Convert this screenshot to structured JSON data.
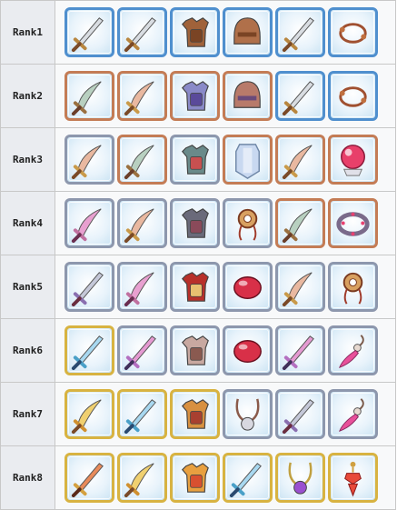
{
  "frame_colors": {
    "blue": "#4f8fce",
    "copper": "#c47c55",
    "silver": "#8d97ad",
    "gold": "#d8b341"
  },
  "ranks": [
    {
      "label": "Rank1",
      "items": [
        {
          "icon": "sword-icon",
          "frame": "blue"
        },
        {
          "icon": "sword-icon",
          "frame": "blue"
        },
        {
          "icon": "leather-armor-icon",
          "frame": "blue"
        },
        {
          "icon": "leather-helmet-icon",
          "frame": "blue"
        },
        {
          "icon": "sword-icon",
          "frame": "blue"
        },
        {
          "icon": "cord-bracelet-icon",
          "frame": "blue"
        }
      ]
    },
    {
      "label": "Rank2",
      "items": [
        {
          "icon": "serrated-sickle-icon",
          "frame": "copper"
        },
        {
          "icon": "curved-dagger-icon",
          "frame": "copper"
        },
        {
          "icon": "plate-armor-icon",
          "frame": "copper"
        },
        {
          "icon": "plumed-helmet-icon",
          "frame": "copper"
        },
        {
          "icon": "sword-icon",
          "frame": "blue"
        },
        {
          "icon": "cord-bracelet-icon",
          "frame": "blue"
        }
      ]
    },
    {
      "label": "Rank3",
      "items": [
        {
          "icon": "curved-dagger-icon",
          "frame": "silver"
        },
        {
          "icon": "serrated-sickle-icon",
          "frame": "copper"
        },
        {
          "icon": "robot-armor-icon",
          "frame": "silver"
        },
        {
          "icon": "crystal-shield-icon",
          "frame": "copper"
        },
        {
          "icon": "curved-dagger-icon",
          "frame": "copper"
        },
        {
          "icon": "crystal-ball-icon",
          "frame": "copper"
        }
      ]
    },
    {
      "label": "Rank4",
      "items": [
        {
          "icon": "pink-dagger-icon",
          "frame": "silver"
        },
        {
          "icon": "curved-dagger-icon",
          "frame": "silver"
        },
        {
          "icon": "dark-armor-icon",
          "frame": "silver"
        },
        {
          "icon": "amulet-icon",
          "frame": "silver"
        },
        {
          "icon": "serrated-sickle-icon",
          "frame": "copper"
        },
        {
          "icon": "gem-bracelet-icon",
          "frame": "copper"
        }
      ]
    },
    {
      "label": "Rank5",
      "items": [
        {
          "icon": "ornate-sword-icon",
          "frame": "silver"
        },
        {
          "icon": "pink-dagger-icon",
          "frame": "silver"
        },
        {
          "icon": "caped-armor-icon",
          "frame": "silver"
        },
        {
          "icon": "red-gem-icon",
          "frame": "silver"
        },
        {
          "icon": "curved-dagger-icon",
          "frame": "silver"
        },
        {
          "icon": "amulet-icon",
          "frame": "silver"
        }
      ]
    },
    {
      "label": "Rank6",
      "items": [
        {
          "icon": "blue-blade-icon",
          "frame": "gold"
        },
        {
          "icon": "pink-blade-icon",
          "frame": "silver"
        },
        {
          "icon": "knight-armor-icon",
          "frame": "silver"
        },
        {
          "icon": "red-gem-icon",
          "frame": "silver"
        },
        {
          "icon": "pink-blade-icon",
          "frame": "silver"
        },
        {
          "icon": "feather-charm-icon",
          "frame": "silver"
        }
      ]
    },
    {
      "label": "Rank7",
      "items": [
        {
          "icon": "golden-blade-icon",
          "frame": "gold"
        },
        {
          "icon": "blue-blade-icon",
          "frame": "gold"
        },
        {
          "icon": "golden-armor-icon",
          "frame": "gold"
        },
        {
          "icon": "silver-charm-icon",
          "frame": "silver"
        },
        {
          "icon": "ornate-sword-icon",
          "frame": "silver"
        },
        {
          "icon": "feather-charm-icon",
          "frame": "silver"
        }
      ]
    },
    {
      "label": "Rank8",
      "items": [
        {
          "icon": "flame-dagger-icon",
          "frame": "gold"
        },
        {
          "icon": "golden-blade-icon",
          "frame": "gold"
        },
        {
          "icon": "royal-armor-icon",
          "frame": "gold"
        },
        {
          "icon": "blue-blade-icon",
          "frame": "gold"
        },
        {
          "icon": "purple-gem-pendant-icon",
          "frame": "gold"
        },
        {
          "icon": "ruby-earring-icon",
          "frame": "gold"
        }
      ]
    }
  ]
}
